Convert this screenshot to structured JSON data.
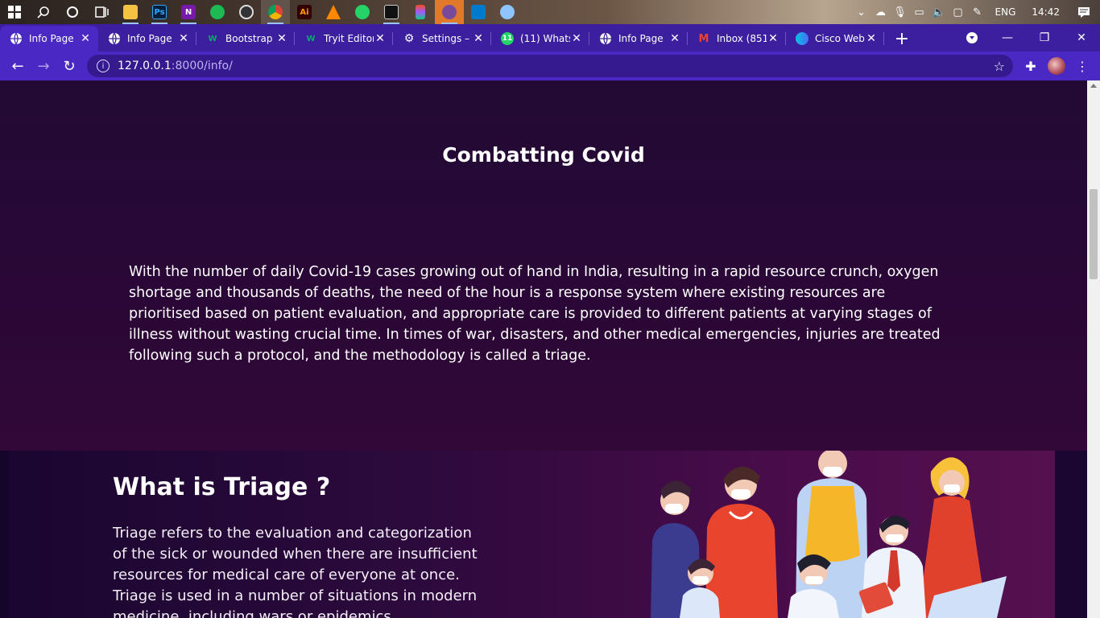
{
  "taskbar": {
    "apps": [
      {
        "icon": "windows-start-icon"
      },
      {
        "icon": "search-icon"
      },
      {
        "icon": "cortana-icon"
      },
      {
        "icon": "task-view-icon"
      },
      {
        "icon": "file-explorer-icon"
      },
      {
        "icon": "photoshop-icon",
        "label": "Ps"
      },
      {
        "icon": "onenote-icon",
        "label": "N"
      },
      {
        "icon": "spotify-icon"
      },
      {
        "icon": "obs-icon"
      },
      {
        "icon": "chrome-icon"
      },
      {
        "icon": "illustrator-icon",
        "label": "Ai"
      },
      {
        "icon": "vlc-icon"
      },
      {
        "icon": "whatsapp-icon"
      },
      {
        "icon": "terminal-icon"
      },
      {
        "icon": "figma-icon"
      },
      {
        "icon": "app-icon"
      },
      {
        "icon": "vscode-icon"
      },
      {
        "icon": "paint-icon"
      }
    ],
    "tray": {
      "language": "ENG",
      "time": "14:42"
    }
  },
  "browser": {
    "tabs": [
      {
        "title": "Info Page",
        "favicon": "globe-icon",
        "active": true
      },
      {
        "title": "Info Page",
        "favicon": "globe-icon"
      },
      {
        "title": "Bootstrap ·",
        "favicon": "w3-icon"
      },
      {
        "title": "Tryit Editor",
        "favicon": "w3-icon"
      },
      {
        "title": "Settings – I",
        "favicon": "gear-icon"
      },
      {
        "title": "(11) Whats",
        "favicon": "whatsapp-icon"
      },
      {
        "title": "Info Page",
        "favicon": "globe-icon"
      },
      {
        "title": "Inbox (851",
        "favicon": "gmail-icon"
      },
      {
        "title": "Cisco Web",
        "favicon": "webex-icon"
      }
    ],
    "url": {
      "host": "127.0.0.1",
      "path": ":8000/info/"
    }
  },
  "page": {
    "heading": "Combatting Covid",
    "intro": "With the number of daily Covid-19 cases growing out of hand in India, resulting in a rapid resource crunch, oxygen shortage and thousands of deaths, the need of the hour is a response system where existing resources are prioritised based on patient evaluation, and appropriate care is provided to different patients at varying stages of illness without wasting crucial time. In times of war, disasters, and other medical emergencies, injuries are treated following such a protocol, and the methodology is called a triage.",
    "triage_heading": "What is Triage ?",
    "triage_text": "Triage refers to the evaluation and categorization of the sick or wounded when there are insufficient resources for medical care of everyone at once. Triage is used in a number of situations in modern medicine, including wars or epidemics"
  },
  "colors": {
    "chrome_frame": "#3b1f9e",
    "chrome_active": "#4a28c4",
    "page_bg": "#220a35"
  }
}
